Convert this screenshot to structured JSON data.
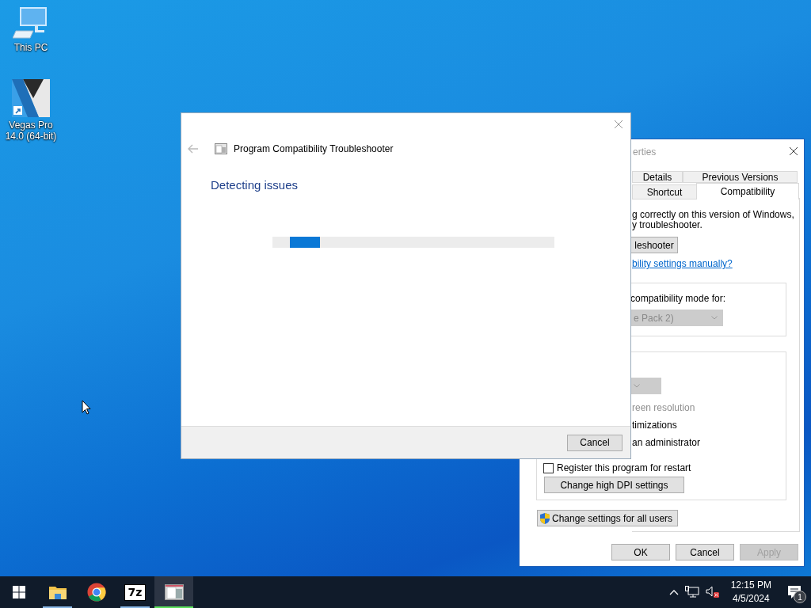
{
  "desktop_icons": [
    {
      "kind": "computer",
      "label": "This PC"
    },
    {
      "kind": "shortcut",
      "label": "Vegas Pro 14.0 (64-bit)"
    }
  ],
  "properties_window": {
    "title": "erties",
    "tabs": [
      {
        "label": "Details",
        "selected": false
      },
      {
        "label": "Previous Versions",
        "selected": false
      },
      {
        "label": "Shortcut",
        "selected": false
      },
      {
        "label": "Compatibility",
        "selected": true
      }
    ],
    "intro_lines": [
      "g correctly on this version of Windows,",
      "y troubleshooter."
    ],
    "run_button": "leshooter",
    "manual_link": "bility settings manually?",
    "mode_label": "compatibility mode for:",
    "mode_dropdown": {
      "value": "e Pack 2)",
      "disabled": true
    },
    "settings_dropdown": {
      "disabled": true
    },
    "settings": [
      {
        "label": "reen resolution",
        "disabled": true
      },
      {
        "label": "timizations",
        "disabled": false
      },
      {
        "label": "an administrator",
        "disabled": false
      }
    ],
    "restart_checkbox": {
      "label": "Register this program for restart",
      "checked": false
    },
    "dpi_button": "Change high DPI settings",
    "all_users_button": "Change settings for all users",
    "buttons": [
      {
        "label": "OK",
        "disabled": false
      },
      {
        "label": "Cancel",
        "disabled": false
      },
      {
        "label": "Apply",
        "disabled": true
      }
    ]
  },
  "troubleshooter": {
    "title": "Program Compatibility Troubleshooter",
    "heading": "Detecting issues",
    "progress": {
      "level": 0.11
    },
    "cancel": "Cancel"
  },
  "taskbar": {
    "apps": [
      {
        "kind": "explorer",
        "running": true,
        "selected": false
      },
      {
        "kind": "chrome",
        "running": false,
        "selected": false
      },
      {
        "kind": "sevenzip",
        "label": "7z",
        "running": true,
        "selected": false
      },
      {
        "kind": "troubleshooter",
        "running": true,
        "selected": true
      }
    ],
    "time": "12:15 PM",
    "date": "4/5/2024",
    "notifications": "1"
  }
}
